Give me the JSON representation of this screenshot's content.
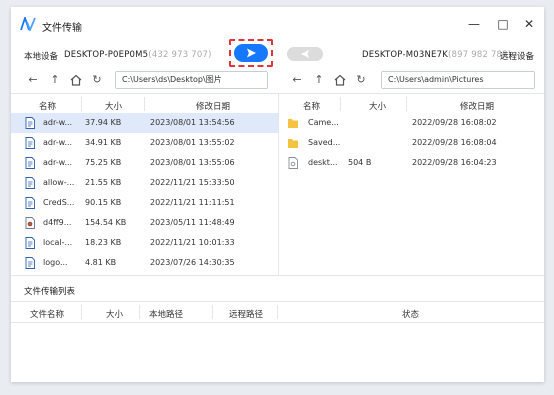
{
  "app": {
    "title": "文件传输"
  },
  "window_controls": {
    "minimize": "—",
    "maximize": "□",
    "close": "✕"
  },
  "local_device": {
    "label": "本地设备",
    "name": "DESKTOP-P0EP0M5",
    "ip": "(432 973 707)"
  },
  "remote_device": {
    "label": "远程设备",
    "name": "DESKTOP-M03NE7K",
    "ip": "(897 982 788)"
  },
  "local_nav": {
    "path": "C:\\Users\\ds\\Desktop\\图片"
  },
  "remote_nav": {
    "path": "C:\\Users\\admin\\Pictures"
  },
  "local_columns": {
    "name": "名称",
    "size": "大小",
    "date": "修改日期"
  },
  "remote_columns": {
    "name": "名称",
    "size": "大小",
    "date": "修改日期"
  },
  "local_files": [
    {
      "name": "adr-w...",
      "size": "37.94 KB",
      "date": "2023/08/01 13:54:56",
      "icon": "document-icon",
      "selected": true
    },
    {
      "name": "adr-w...",
      "size": "34.91 KB",
      "date": "2023/08/01 13:55:02",
      "icon": "document-icon"
    },
    {
      "name": "adr-w...",
      "size": "75.25 KB",
      "date": "2023/08/01 13:55:06",
      "icon": "document-icon"
    },
    {
      "name": "allow-...",
      "size": "21.55 KB",
      "date": "2022/11/21 15:33:50",
      "icon": "document-icon"
    },
    {
      "name": "CredS...",
      "size": "90.15 KB",
      "date": "2022/11/21 11:11:51",
      "icon": "document-icon"
    },
    {
      "name": "d4ff9...",
      "size": "154.54 KB",
      "date": "2023/05/11 11:48:49",
      "icon": "image-icon"
    },
    {
      "name": "local-...",
      "size": "18.23 KB",
      "date": "2022/11/21 10:01:33",
      "icon": "document-icon"
    },
    {
      "name": "logo...",
      "size": "4.81 KB",
      "date": "2023/07/26 14:30:35",
      "icon": "document-icon"
    }
  ],
  "remote_files": [
    {
      "name": "Came...",
      "size": "",
      "date": "2022/09/28 16:08:02",
      "icon": "folder-icon"
    },
    {
      "name": "Saved...",
      "size": "",
      "date": "2022/09/28 16:08:04",
      "icon": "folder-icon"
    },
    {
      "name": "deskt...",
      "size": "504 B",
      "date": "2022/09/28 16:04:23",
      "icon": "settings-file-icon"
    }
  ],
  "transfer_list": {
    "title": "文件传输列表",
    "columns": {
      "name": "文件名称",
      "size": "大小",
      "local_path": "本地路径",
      "remote_path": "远程路径",
      "status": "状态"
    }
  },
  "colors": {
    "accent": "#1677ff",
    "highlight": "#e2333b",
    "selected_row": "#dfe9fa",
    "folder": "#f5c342"
  }
}
